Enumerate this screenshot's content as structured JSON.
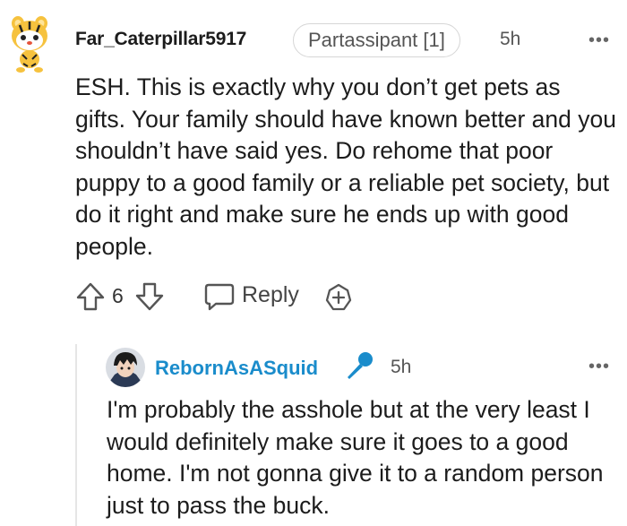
{
  "comment": {
    "username": "Far_Caterpillar5917",
    "flair": "Partassipant [1]",
    "time": "5h",
    "body": "ESH. This is exactly why you don’t get pets as gifts. Your family should have known better and you shouldn’t have said yes. Do rehome that poor puppy to a good family or a reliable pet society, but do it right and make sure he ends up with good people.",
    "votes": "6",
    "reply_label": "Reply",
    "more_label": "•••"
  },
  "reply": {
    "username": "RebornAsASquid",
    "time": "5h",
    "body": "I'm probably the asshole but at the very least I would definitely make sure it goes to a good home. I'm not gonna give it to a random person just to pass the buck.",
    "more_label": "•••"
  },
  "colors": {
    "username_reply": "#1a8ccb",
    "mic_icon": "#1a8ccb",
    "text": "#1c1c1c",
    "meta": "#555555"
  },
  "icons": [
    "snoo-avatar-icon",
    "upvote-icon",
    "downvote-icon",
    "reply-icon",
    "award-icon",
    "microphone-icon",
    "more-options-icon"
  ]
}
